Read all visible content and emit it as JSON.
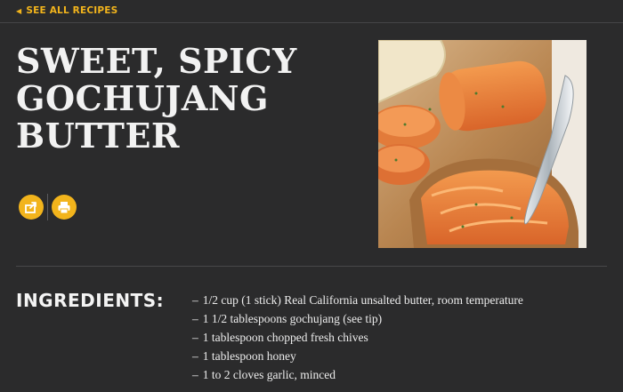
{
  "nav": {
    "back_label": "SEE ALL RECIPES"
  },
  "recipe": {
    "title_lines": [
      "SWEET, SPICY",
      "GOCHUJANG",
      "BUTTER"
    ],
    "photo_alt": "Sweet, Spicy Gochujang Butter"
  },
  "actions": {
    "share_icon": "share-icon",
    "print_icon": "print-icon"
  },
  "ingredients": {
    "heading": "INGREDIENTS:",
    "items": [
      "1/2 cup (1 stick) Real California unsalted butter, room temperature",
      "1 1/2 tablespoons gochujang (see tip)",
      "1 tablespoon chopped fresh chives",
      "1 tablespoon honey",
      "1 to 2 cloves garlic, minced"
    ]
  },
  "colors": {
    "accent": "#f2b41c",
    "background": "#2b2b2c",
    "text": "#f2f2f2"
  }
}
